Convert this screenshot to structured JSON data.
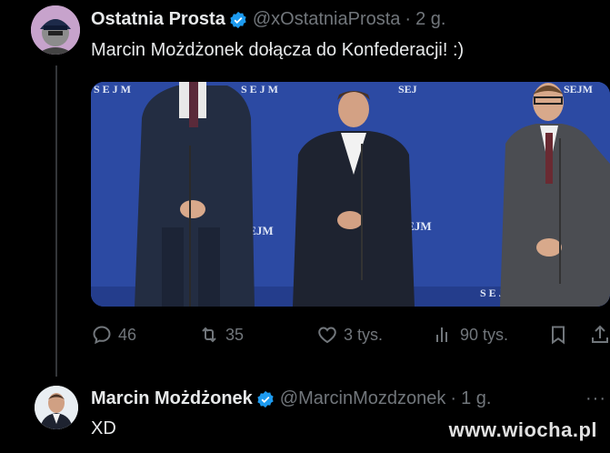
{
  "tweet": {
    "author_name": "Ostatnia Prosta",
    "handle": "@xOstatniaProsta",
    "separator": "·",
    "time": "2 g.",
    "text": "Marcin Możdżonek dołącza do Konfederacji! :)",
    "media_signs": [
      "S E J M",
      "S E J M",
      "SEJ",
      "SEJM",
      "SEJM",
      "SEJM",
      "S E J M"
    ],
    "actions": {
      "replies": "46",
      "reposts": "35",
      "likes": "3 tys.",
      "views": "90 tys."
    }
  },
  "reply": {
    "author_name": "Marcin Możdżonek",
    "handle": "@MarcinMozdzonek",
    "separator": "·",
    "time": "1 g.",
    "text": "XD",
    "more": "···"
  },
  "watermark": "www.wiocha.pl",
  "colors": {
    "background": "#000000",
    "text": "#e7e9ea",
    "muted": "#71767b",
    "verified": "#1d9bf0",
    "sejm_backdrop": "#2c4aa3"
  }
}
